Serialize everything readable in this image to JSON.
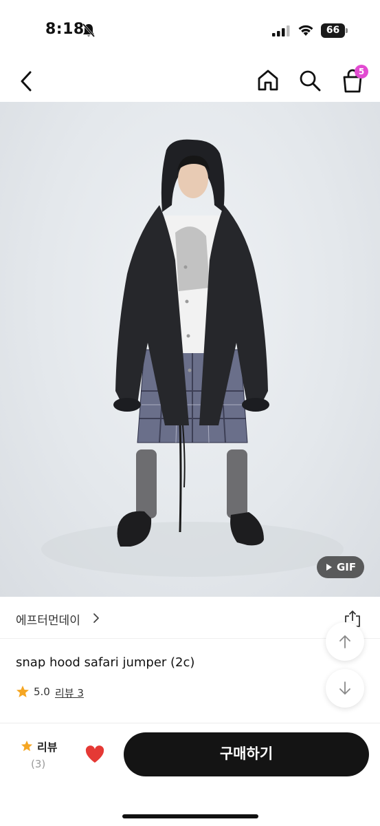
{
  "status_bar": {
    "time": "8:18",
    "battery": "66",
    "icons": [
      "bell-muted-icon",
      "signal-icon",
      "wifi-icon",
      "battery-icon"
    ]
  },
  "nav": {
    "icons": [
      "back-icon",
      "home-icon",
      "search-icon",
      "cart-icon"
    ],
    "cart_badge": "5",
    "badge_color": "#e24bd1"
  },
  "media": {
    "gif_label": "GIF"
  },
  "product": {
    "brand": "에프터먼데이",
    "title": "snap hood safari jumper (2c)",
    "rating": "5.0",
    "review_link": "리뷰 3",
    "star_color": "#f5a623"
  },
  "bottom_bar": {
    "review_label": "리뷰",
    "review_count": "(3)",
    "buy_label": "구매하기",
    "heart_color": "#e53935",
    "button_color": "#141414"
  }
}
